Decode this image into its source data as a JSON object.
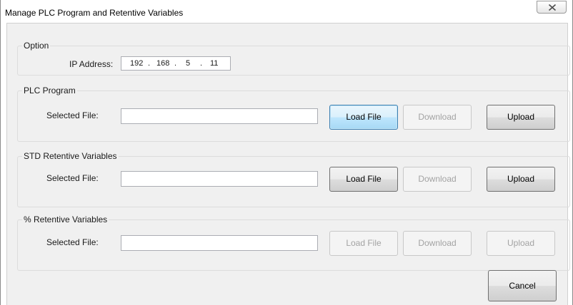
{
  "window": {
    "title": "Manage PLC Program and Retentive Variables",
    "close_icon": "close-x-icon"
  },
  "option": {
    "title": "Option",
    "ip_label": "IP Address:",
    "ip": [
      "192",
      "168",
      "5",
      "11"
    ],
    "dot": "."
  },
  "plc_program": {
    "title": "PLC Program",
    "file_label": "Selected File:",
    "file_value": "",
    "load_label": "Load File",
    "download_label": "Download",
    "upload_label": "Upload"
  },
  "std_retentive": {
    "title": "STD Retentive Variables",
    "file_label": "Selected File:",
    "file_value": "",
    "load_label": "Load File",
    "download_label": "Download",
    "upload_label": "Upload"
  },
  "pct_retentive": {
    "title": "% Retentive Variables",
    "file_label": "Selected File:",
    "file_value": "",
    "load_label": "Load File",
    "download_label": "Download",
    "upload_label": "Upload"
  },
  "cancel_label": "Cancel"
}
